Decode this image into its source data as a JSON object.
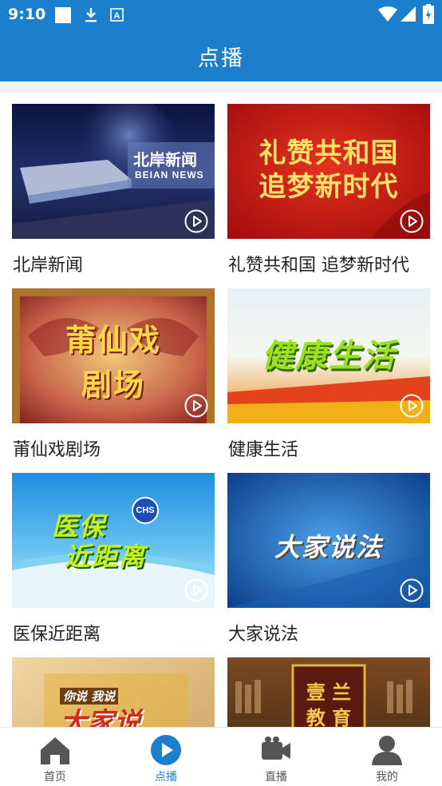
{
  "status_bar": {
    "time": "9:10",
    "icons": [
      "square-icon",
      "download-icon",
      "a-box-icon",
      "wifi-icon",
      "signal-icon",
      "battery-icon"
    ]
  },
  "app_bar": {
    "title": "点播"
  },
  "programs": [
    {
      "title": "北岸新闻",
      "thumb_text": "北岸新闻",
      "thumb_subtext": "BEIAN NEWS"
    },
    {
      "title": "礼赞共和国 追梦新时代",
      "thumb_text": "礼赞共和国",
      "thumb_subtext": "追梦新时代"
    },
    {
      "title": "莆仙戏剧场",
      "thumb_text": "莆仙戏",
      "thumb_subtext": "剧场"
    },
    {
      "title": "健康生活",
      "thumb_text": "健康生活",
      "thumb_subtext": ""
    },
    {
      "title": "医保近距离",
      "thumb_text": "医保",
      "thumb_subtext": "近距离",
      "thumb_badge": "CHS"
    },
    {
      "title": "大家说法",
      "thumb_text": "大家说法",
      "thumb_subtext": ""
    },
    {
      "title": "",
      "thumb_text": "大家说",
      "thumb_subtext": "你说 我说"
    },
    {
      "title": "",
      "thumb_text": "壹 兰",
      "thumb_subtext": "教 育"
    }
  ],
  "tab_bar": {
    "items": [
      {
        "label": "首页",
        "icon": "home-icon",
        "active": false
      },
      {
        "label": "点播",
        "icon": "play-circle-icon",
        "active": true
      },
      {
        "label": "直播",
        "icon": "video-camera-icon",
        "active": false
      },
      {
        "label": "我的",
        "icon": "person-icon",
        "active": false
      }
    ]
  },
  "colors": {
    "primary": "#1c7fcd",
    "inactive": "#555555"
  }
}
